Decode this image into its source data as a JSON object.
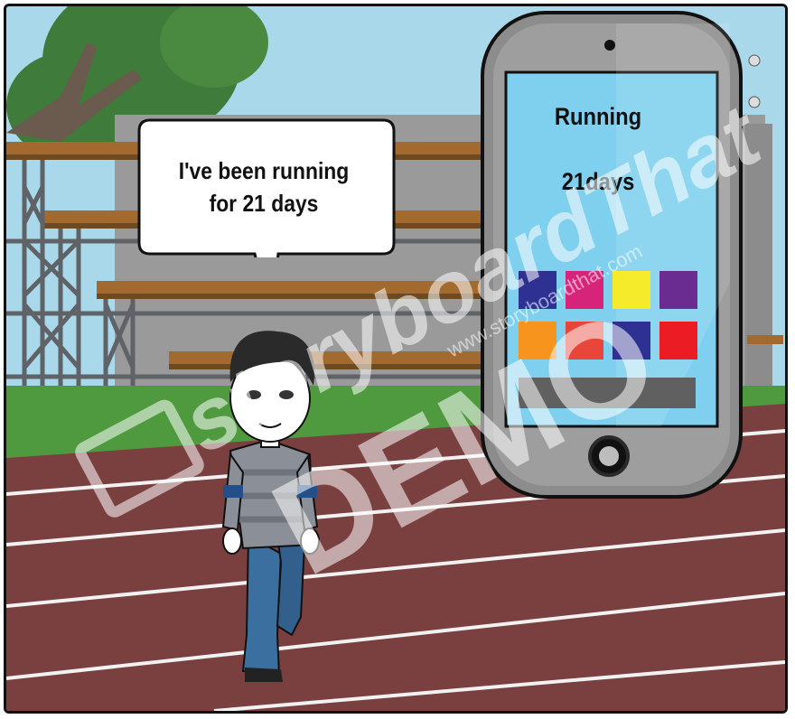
{
  "speech": {
    "line1": "I've been running",
    "line2": "for 21 days"
  },
  "phone": {
    "title": "Running",
    "days": "21days",
    "tiles": [
      "#2e3192",
      "#d6247a",
      "#f5eb2a",
      "#6a2c91",
      "#f7941d",
      "#e8463a",
      "#2e3192",
      "#ec1c24"
    ]
  },
  "watermark": {
    "brand": "storyboardThat",
    "url": "www.storyboardthat.com",
    "demo": "DEMO"
  },
  "colors": {
    "sky": "#a9d8ea",
    "grass": "#4f9a3e",
    "track": "#7a4040",
    "phone_screen": "#7fd0ee"
  }
}
